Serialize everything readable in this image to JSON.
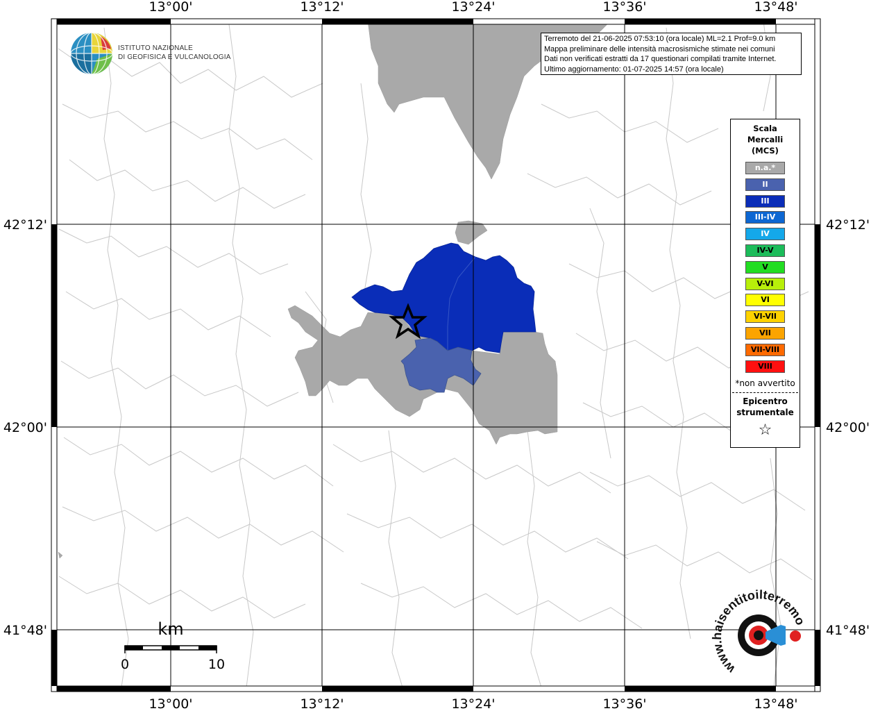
{
  "map": {
    "top_axis_labels": [
      "13°00'",
      "13°12'",
      "13°24'",
      "13°36'",
      "13°48'"
    ],
    "bottom_axis_labels": [
      "13°00'",
      "13°12'",
      "13°24'",
      "13°36'",
      "13°48'"
    ],
    "left_axis_labels": [
      "42°12'",
      "42°00'",
      "41°48'"
    ],
    "right_axis_labels": [
      "42°12'",
      "42°00'",
      "41°48'"
    ]
  },
  "info": {
    "line1": "Terremoto del 21-06-2025 07:53:10 (ora locale) ML=2.1 Prof=9.0 km",
    "line2": "Mappa preliminare delle intensità macrosismiche stimate nei comuni",
    "line3": "Dati non verificati estratti da 17 questionari compilati tramite Internet.",
    "line4": "Ultimo aggiornamento: 01-07-2025 14:57 (ora locale)"
  },
  "logo": {
    "line1": "ISTITUTO NAZIONALE",
    "line2": "DI GEOFISICA E VULCANOLOGIA"
  },
  "legend": {
    "title1": "Scala",
    "title2": "Mercalli",
    "title3": "(MCS)",
    "items": [
      {
        "label": "n.a.*",
        "color": "#a9a9a9",
        "text_color": "#ffffff"
      },
      {
        "label": "II",
        "color": "#4a62ae",
        "text_color": "#ffffff"
      },
      {
        "label": "III",
        "color": "#0a2db8",
        "text_color": "#ffffff"
      },
      {
        "label": "III-IV",
        "color": "#0d67d2",
        "text_color": "#ffffff"
      },
      {
        "label": "IV",
        "color": "#14a8ea",
        "text_color": "#ffffff"
      },
      {
        "label": "IV-V",
        "color": "#1cbc5a",
        "text_color": "#000000"
      },
      {
        "label": "V",
        "color": "#22dd22",
        "text_color": "#000000"
      },
      {
        "label": "V-VI",
        "color": "#b8ef0a",
        "text_color": "#000000"
      },
      {
        "label": "VI",
        "color": "#ffff00",
        "text_color": "#000000"
      },
      {
        "label": "VI-VII",
        "color": "#fdd200",
        "text_color": "#000000"
      },
      {
        "label": "VII",
        "color": "#fba400",
        "text_color": "#000000"
      },
      {
        "label": "VII-VIII",
        "color": "#ff6a00",
        "text_color": "#000000"
      },
      {
        "label": "VIII",
        "color": "#ff1010",
        "text_color": "#000000"
      }
    ],
    "note": "*non avvertito",
    "epicenter1": "Epicentro",
    "epicenter2": "strumentale",
    "star": "☆"
  },
  "scale_bar": {
    "unit": "km",
    "start": "0",
    "end": "10"
  },
  "watermark": {
    "text": "www.haisentitoilterremoto.it"
  },
  "colors": {
    "na": "#a9a9a9",
    "ii": "#4a62ae",
    "iii": "#0a2db8",
    "boundary": "#c8c8c8"
  }
}
